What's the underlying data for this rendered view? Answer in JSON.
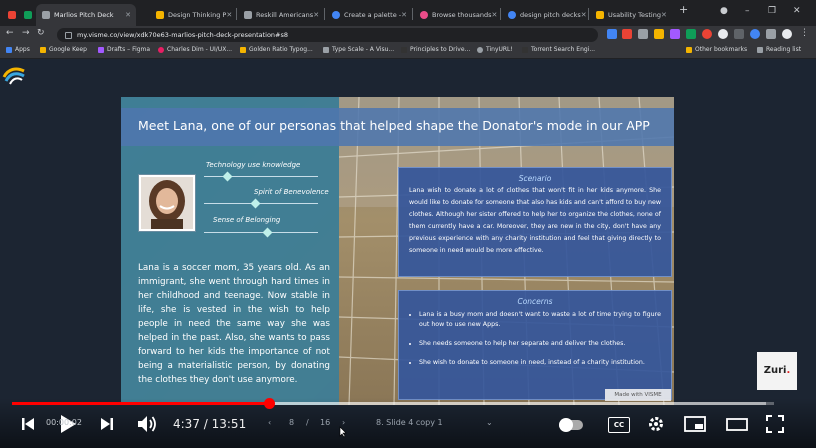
{
  "browser": {
    "tabs": [
      {
        "label": "",
        "active": false,
        "color": "#ea4335"
      },
      {
        "label": "",
        "active": false,
        "color": "#0f9d58"
      },
      {
        "label": "Marlios Pitch Deck",
        "active": true,
        "color": "#9aa0a6"
      },
      {
        "label": "Design Thinking P",
        "active": false,
        "color": "#f4b400"
      },
      {
        "label": "Reskill Americans",
        "active": false,
        "color": "#9aa0a6"
      },
      {
        "label": "Create a palette -",
        "active": false,
        "color": "#4285f4"
      },
      {
        "label": "Browse thousands",
        "active": false,
        "color": "#ea4c89"
      },
      {
        "label": "design pitch decks",
        "active": false,
        "color": "#4285f4"
      },
      {
        "label": "Usability Testing",
        "active": false,
        "color": "#f4b400"
      }
    ],
    "new_tab_symbol": "+",
    "url": "my.visme.co/view/xdk70e63-marlios-pitch-deck-presentation#s8",
    "bookmarks": [
      {
        "label": "Apps",
        "color": "#4285f4"
      },
      {
        "label": "Google Keep",
        "color": "#f4b400"
      },
      {
        "label": "Drafts – Figma",
        "color": "#a259ff"
      },
      {
        "label": "Charles Dim - UI/UX...",
        "color": "#e91e63"
      },
      {
        "label": "Golden Ratio Typog...",
        "color": "#f4b400"
      },
      {
        "label": "Type Scale - A Visu...",
        "color": "#9aa0a6"
      },
      {
        "label": "Principles to Drive...",
        "color": "#333333"
      },
      {
        "label": "TinyURL!",
        "color": "#9aa0a6"
      },
      {
        "label": "Torrent Search Engi...",
        "color": "#333333"
      }
    ],
    "other_bookmarks": "Other bookmarks",
    "reading_list": "Reading list"
  },
  "slide": {
    "title": "Meet Lana, one of our personas that helped shape the Donator's mode in our APP",
    "skills": [
      {
        "label": "Technology use knowledge",
        "level": 0.2
      },
      {
        "label": "Spirit of Benevolence",
        "level": 0.45
      },
      {
        "label": "Sense of Belonging",
        "level": 0.55
      }
    ],
    "bio": "Lana is a soccer mom, 35 years old. As an immigrant, she went through hard times in her childhood and teenage. Now stable in life, she is vested in the wish to help people in need the same way she was helped in the past. Also, she wants to pass forward to her kids the importance of not being a materialistic person, by donating the clothes they don't use anymore.",
    "scenario": {
      "title": "Scenario",
      "text": "Lana wish to donate a lot of clothes that won't fit in her kids anymore. She would like to donate for someone that also has kids and can't afford to buy new clothes. Although her sister offered to help her to organize the clothes, none of them currently have a car. Moreover, they are new in the city, don't have any previous experience with any charity institution and feel that giving directly to someone in need would be more effective."
    },
    "concerns": {
      "title": "Concerns",
      "items": [
        "Lana is a busy mom and doesn't want to waste a lot of time trying to figure out how to use new Apps.",
        "She needs someone to help her separate and deliver the clothes.",
        "She wish to donate to someone in need, instead of a charity institution."
      ]
    },
    "made_with": "Made with VISME"
  },
  "player": {
    "time": "4:37 / 13:51",
    "progress": 0.337,
    "buffered": 0.99,
    "presenter": {
      "page": "8",
      "separator": "/",
      "total": "16",
      "slide_name": "8. Slide 4 copy 1",
      "left_time": "00:00:02"
    },
    "cc_label": "CC",
    "channel_watermark": "Zuri"
  }
}
